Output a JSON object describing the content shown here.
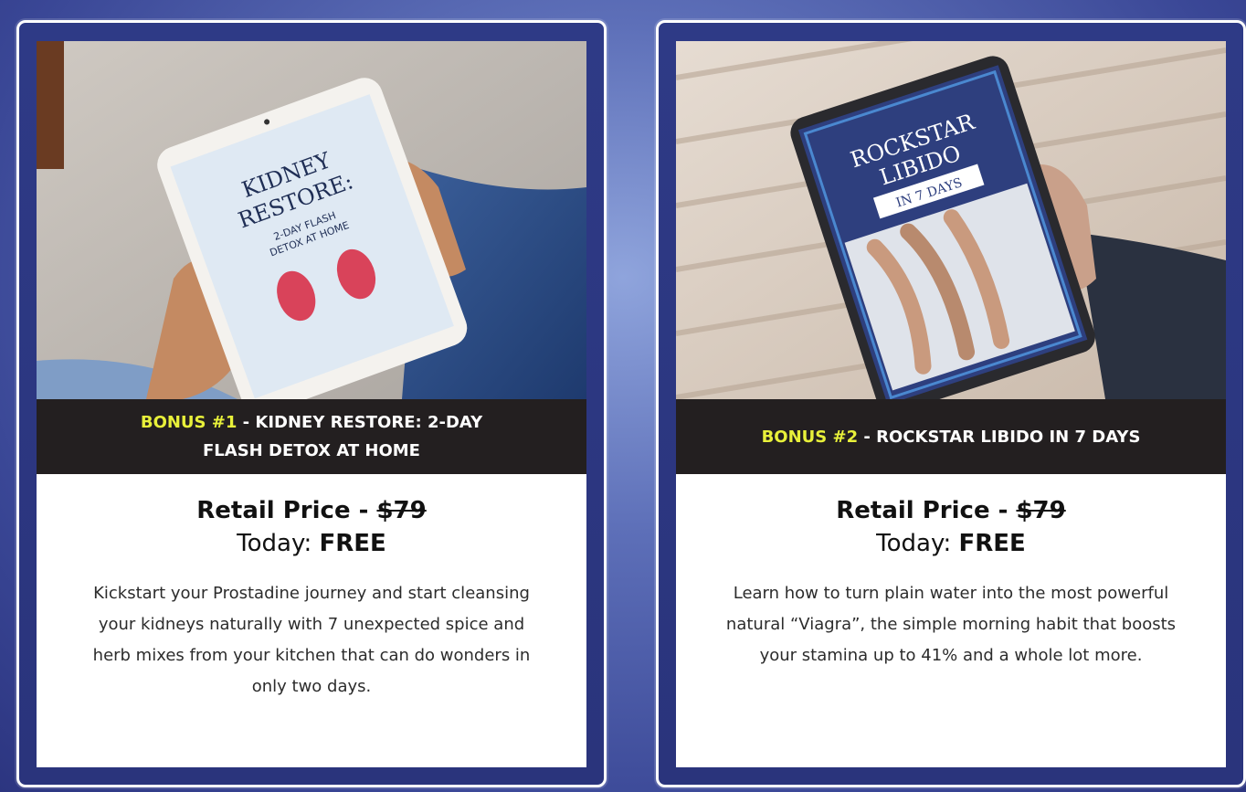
{
  "bonuses": [
    {
      "bonus_tag": "BONUS #1",
      "separator": " - ",
      "title_line1": "KIDNEY RESTORE: 2-DAY",
      "title_line2": "FLASH DETOX AT HOME",
      "retail_label": "Retail Price - ",
      "retail_price": "$79",
      "today_label": "Today: ",
      "today_value": "FREE",
      "description": "Kickstart your Prostadine journey and start cleansing your kidneys naturally with 7 unexpected spice and herb mixes from your kitchen that can do wonders in only two days.",
      "ebook_title_line1": "KIDNEY",
      "ebook_title_line2": "RESTORE:",
      "ebook_sub_line1": "2-DAY FLASH",
      "ebook_sub_line2": "DETOX AT HOME"
    },
    {
      "bonus_tag": "BONUS #2",
      "separator": " - ",
      "title_line1": "ROCKSTAR LIBIDO IN 7 DAYS",
      "title_line2": "",
      "retail_label": "Retail Price - ",
      "retail_price": "$79",
      "today_label": "Today: ",
      "today_value": "FREE",
      "description": "Learn how to turn plain water into the most powerful natural “Viagra”, the simple morning habit that boosts your stamina up to 41% and a whole lot more.",
      "ebook_title_line1": "ROCKSTAR",
      "ebook_title_line2": "LIBIDO",
      "ebook_ribbon": "IN 7 DAYS"
    }
  ],
  "colors": {
    "background": "#3a4796",
    "banner": "#231f20",
    "bonus_highlight": "#e8f03a",
    "card_border": "#ffffff"
  }
}
